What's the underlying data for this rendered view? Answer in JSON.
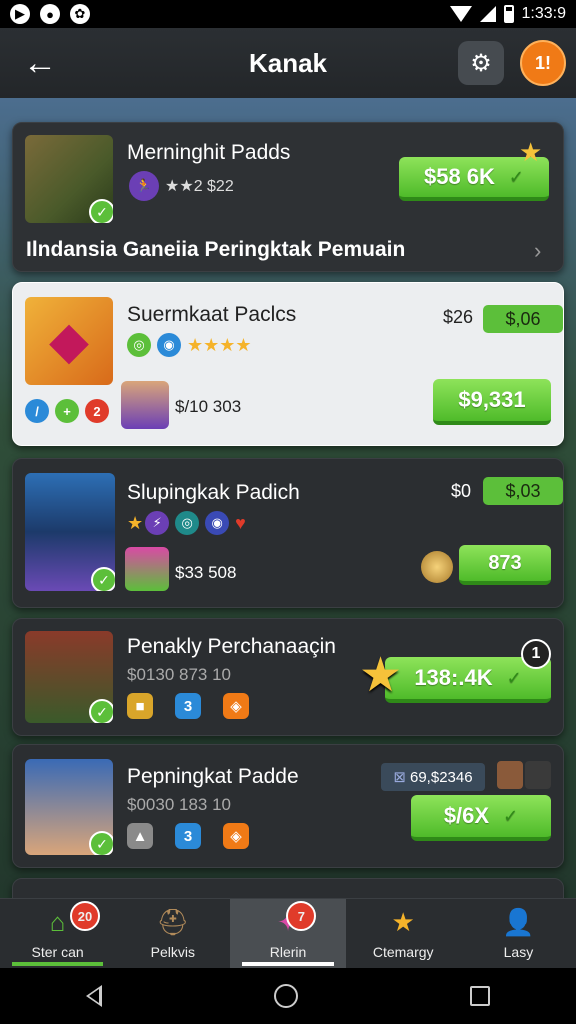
{
  "status_bar": {
    "time": "1:33:9",
    "icons": [
      "notification-icon",
      "app-icon",
      "app-icon-2",
      "wifi-icon",
      "signal-icon",
      "battery-icon"
    ]
  },
  "app_bar": {
    "title": "Kanak",
    "notification_badge": "1!"
  },
  "section_title": "Ilndansia Ganeiia Peringktak Pemuain",
  "cards": [
    {
      "name": "Merninghit Padds",
      "rating_text": "★★2  $22",
      "button": "$58 6K"
    },
    {
      "name": "Suermkaat Paclcs",
      "price_small": "$26",
      "pill": "$,06",
      "sub_price": "$/10 303",
      "badges": [
        "2"
      ],
      "button": "$9,331"
    },
    {
      "name": "Slupingkak Padich",
      "price_small": "$0",
      "pill": "$,03",
      "sub_price": "$33 508",
      "button": "873"
    },
    {
      "name": "Penakly Perchanaaçin",
      "sub_price": "$0130 873 10",
      "square_label": "3",
      "button": "138:.4K",
      "count_badge": "1"
    },
    {
      "name": "Pepningkat Padde",
      "sub_price": "$0030 183 10",
      "square_label": "3",
      "tag": "69,$2346",
      "button": "$/6X"
    }
  ],
  "bottom_nav": [
    {
      "label": "Ster can",
      "badge": "20"
    },
    {
      "label": "Pelkvis",
      "badge": ""
    },
    {
      "label": "Rlerin",
      "badge": "7"
    },
    {
      "label": "Ctemargy",
      "badge": ""
    },
    {
      "label": "Lasy",
      "badge": ""
    }
  ],
  "colors": {
    "accent_green": "#5cbf3a",
    "notification_orange": "#f07a16",
    "badge_red": "#e03b2a"
  }
}
